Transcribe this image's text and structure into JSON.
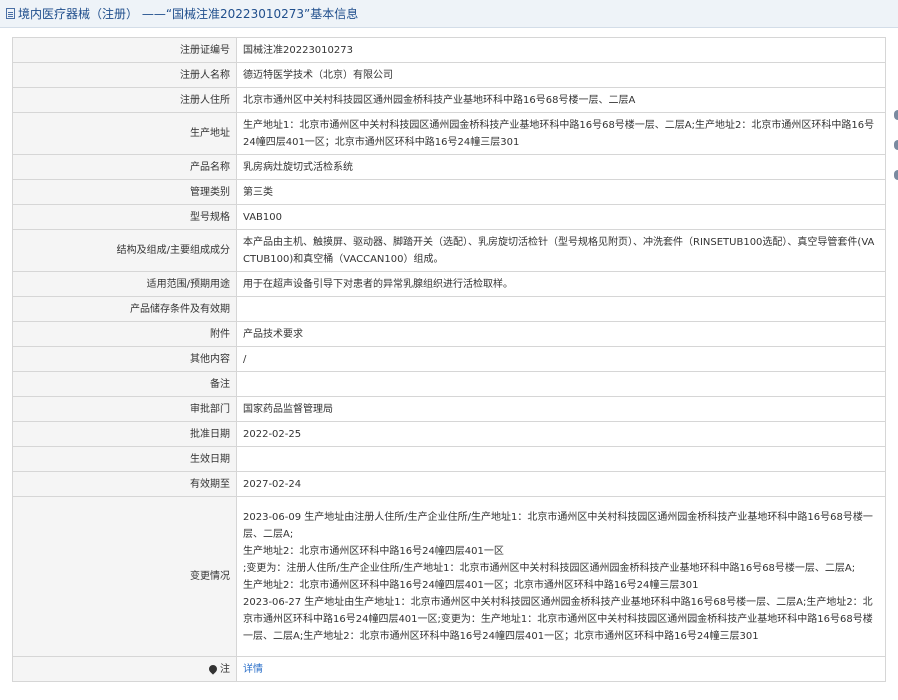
{
  "header": {
    "title": "境内医疗器械（注册） ——“国械注准20223010273”基本信息"
  },
  "rows": [
    {
      "label": "注册证编号",
      "value": "国械注准20223010273"
    },
    {
      "label": "注册人名称",
      "value": "德迈特医学技术（北京）有限公司"
    },
    {
      "label": "注册人住所",
      "value": "北京市通州区中关村科技园区通州园金桥科技产业基地环科中路16号68号楼一层、二层A"
    },
    {
      "label": "生产地址",
      "value": "生产地址1：北京市通州区中关村科技园区通州园金桥科技产业基地环科中路16号68号楼一层、二层A;生产地址2：北京市通州区环科中路16号24幢四层401一区；北京市通州区环科中路16号24幢三层301"
    },
    {
      "label": "产品名称",
      "value": "乳房病灶旋切式活检系统"
    },
    {
      "label": "管理类别",
      "value": "第三类"
    },
    {
      "label": "型号规格",
      "value": "VAB100"
    },
    {
      "label": "结构及组成/主要组成成分",
      "value": "本产品由主机、触摸屏、驱动器、脚踏开关（选配）、乳房旋切活检针（型号规格见附页）、冲洗套件（RINSETUB100选配）、真空导管套件(VACTUB100)和真空桶（VACCAN100）组成。"
    },
    {
      "label": "适用范围/预期用途",
      "value": "用于在超声设备引导下对患者的异常乳腺组织进行活检取样。"
    },
    {
      "label": "产品储存条件及有效期",
      "value": ""
    },
    {
      "label": "附件",
      "value": "产品技术要求"
    },
    {
      "label": "其他内容",
      "value": "/"
    },
    {
      "label": "备注",
      "value": ""
    },
    {
      "label": "审批部门",
      "value": "国家药品监督管理局"
    },
    {
      "label": "批准日期",
      "value": "2022-02-25"
    },
    {
      "label": "生效日期",
      "value": ""
    },
    {
      "label": "有效期至",
      "value": "2027-02-24"
    }
  ],
  "changes": {
    "label": "变更情况",
    "lines": [
      "2023-06-09 生产地址由注册人住所/生产企业住所/生产地址1：北京市通州区中关村科技园区通州园金桥科技产业基地环科中路16号68号楼一层、二层A;",
      "生产地址2：北京市通州区环科中路16号24幢四层401一区",
      ";变更为：注册人住所/生产企业住所/生产地址1：北京市通州区中关村科技园区通州园金桥科技产业基地环科中路16号68号楼一层、二层A;",
      "生产地址2：北京市通州区环科中路16号24幢四层401一区；北京市通州区环科中路16号24幢三层301",
      "2023-06-27 生产地址由生产地址1：北京市通州区中关村科技园区通州园金桥科技产业基地环科中路16号68号楼一层、二层A;生产地址2：北京市通州区环科中路16号24幢四层401一区;变更为：生产地址1：北京市通州区中关村科技园区通州园金桥科技产业基地环科中路16号68号楼一层、二层A;生产地址2：北京市通州区环科中路16号24幢四层401一区；北京市通州区环科中路16号24幢三层301"
    ]
  },
  "note": {
    "label": "注",
    "link": "详情"
  }
}
